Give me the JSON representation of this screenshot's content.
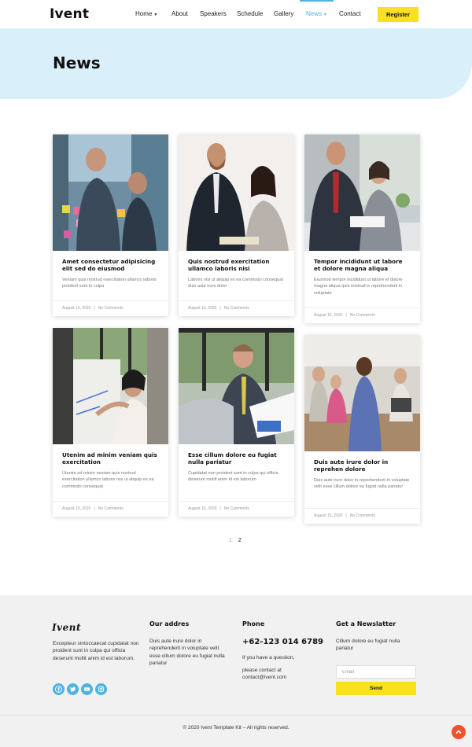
{
  "header": {
    "logo": "Ivent",
    "nav": [
      {
        "label": "Home",
        "caret": "▾"
      },
      {
        "label": "About"
      },
      {
        "label": "Speakers"
      },
      {
        "label": "Schedule"
      },
      {
        "label": "Gallery"
      },
      {
        "label": "News",
        "caret": "▾",
        "active": true
      },
      {
        "label": "Contact"
      }
    ],
    "register_label": "Register"
  },
  "banner": {
    "title": "News"
  },
  "posts": [
    {
      "title": "Amet consectetur adipisicing elit sed do eiusmod",
      "excerpt": "Veniam quis nostrud exercitation ullamco laboris proident sunt in culpa",
      "date": "August 15, 2020",
      "comments": "No Comments",
      "image": "team-sticky-notes-photo"
    },
    {
      "title": "Quis nostrud exercitation ullamco laboris nisi",
      "excerpt": "Laboris nisi ut aliquip ex ea commodo consequat duis aute irure dolor",
      "date": "August 15, 2020",
      "comments": "No Comments",
      "image": "handshake-meeting-photo"
    },
    {
      "title": "Tempor incididunt ut labore et dolore magna aliqua",
      "excerpt": "Eiusmod tempor incididunt ut labore et dolore magna aliqua quis nostrud in reprehenderit in voluptate",
      "date": "August 15, 2020",
      "comments": "No Comments",
      "image": "office-discussion-photo"
    },
    {
      "title": "Utenim ad minim veniam quis exercitation",
      "excerpt": "Utenim ad minim veniam quis nostrud exercitation ullamco laboris nisi ut aliquip ex ea commodo consequat",
      "date": "August 15, 2020",
      "comments": "No Comments",
      "image": "whiteboard-presentation-photo"
    },
    {
      "title": "Esse cillum dolore eu fugiat nulla pariatur",
      "excerpt": "Cupidatat non proident sunt in culpa qui officia deserunt mollit anim id est laborum",
      "date": "August 15, 2020",
      "comments": "No Comments",
      "image": "man-laptop-documents-photo"
    },
    {
      "title": "Duis aute irure dolor in reprehen dolore",
      "excerpt": "Duis aute irure dolor in reprehenderit in voluptate velit esse cillum dolore eu fugiat nulla pariatur",
      "date": "August 15, 2020",
      "comments": "No Comments",
      "image": "woman-in-office-photo"
    }
  ],
  "pagination": {
    "prev": "1",
    "current": "2"
  },
  "footer": {
    "logo": "Ivent",
    "about": "Excepteur sintoccaecat cupidatat non proident sunt in culpa qui officia deserunt mollit anim id est laborum.",
    "address_title": "Our addres",
    "address": "Duis aute irure dolor in reprehenderit in voluptate velit esse cillum dolore eu fugiat nulla pariatur",
    "phone_title": "Phone",
    "phone_number": "+62-123 014 6789",
    "phone_note": "If you have a question,",
    "contact_note": "please contact at contact@ivent.com",
    "newsletter_title": "Get a Newslatter",
    "newsletter_text": "Cillum dolore eu fugiat nulla pariatur",
    "email_placeholder": "Email",
    "send_label": "Send",
    "socials": [
      "facebook-icon",
      "twitter-icon",
      "youtube-icon",
      "instagram-icon"
    ],
    "copyright": "© 2020 Ivent Template Kit – All rights reserved."
  },
  "colors": {
    "accent_blue": "#4fb3e0",
    "accent_yellow": "#fbe022",
    "banner_bg": "#d9f0fb",
    "footer_bg": "#f1f1f1",
    "back_to_top": "#f0522e"
  }
}
